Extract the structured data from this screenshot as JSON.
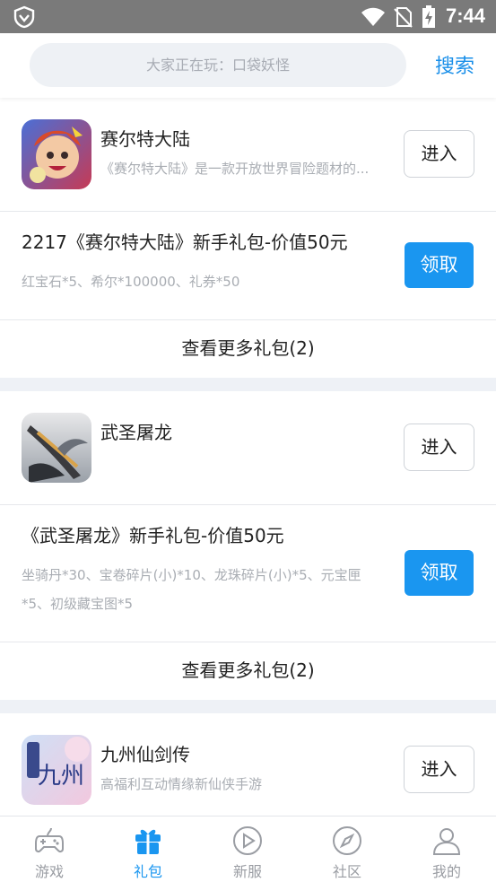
{
  "status_bar": {
    "time": "7:44"
  },
  "search": {
    "placeholder": "大家正在玩：口袋妖怪",
    "button_label": "搜索"
  },
  "games": [
    {
      "name": "赛尔特大陆",
      "description": "《赛尔特大陆》是一款开放世界冒险题材的...",
      "enter_label": "进入",
      "gift": {
        "title": "2217《赛尔特大陆》新手礼包-价值50元",
        "detail": "红宝石*5、希尔*100000、礼券*50",
        "claim_label": "领取"
      },
      "more_label": "查看更多礼包(2)"
    },
    {
      "name": "武圣屠龙",
      "description": "",
      "enter_label": "进入",
      "gift": {
        "title": "《武圣屠龙》新手礼包-价值50元",
        "detail": "坐骑丹*30、宝卷碎片(小)*10、龙珠碎片(小)*5、元宝匣*5、初级藏宝图*5",
        "claim_label": "领取"
      },
      "more_label": "查看更多礼包(2)"
    },
    {
      "name": "九州仙剑传",
      "description": "高福利互动情缘新仙侠手游",
      "enter_label": "进入",
      "icon_text": "九州"
    }
  ],
  "nav": {
    "items": [
      {
        "label": "游戏",
        "icon": "gamepad-icon"
      },
      {
        "label": "礼包",
        "icon": "gift-icon"
      },
      {
        "label": "新服",
        "icon": "play-icon"
      },
      {
        "label": "社区",
        "icon": "compass-icon"
      },
      {
        "label": "我的",
        "icon": "user-icon"
      }
    ],
    "active": "礼包"
  },
  "colors": {
    "accent": "#1a96f0",
    "search_text": "#1a8fe9",
    "status_bar": "#7a7a7a"
  }
}
